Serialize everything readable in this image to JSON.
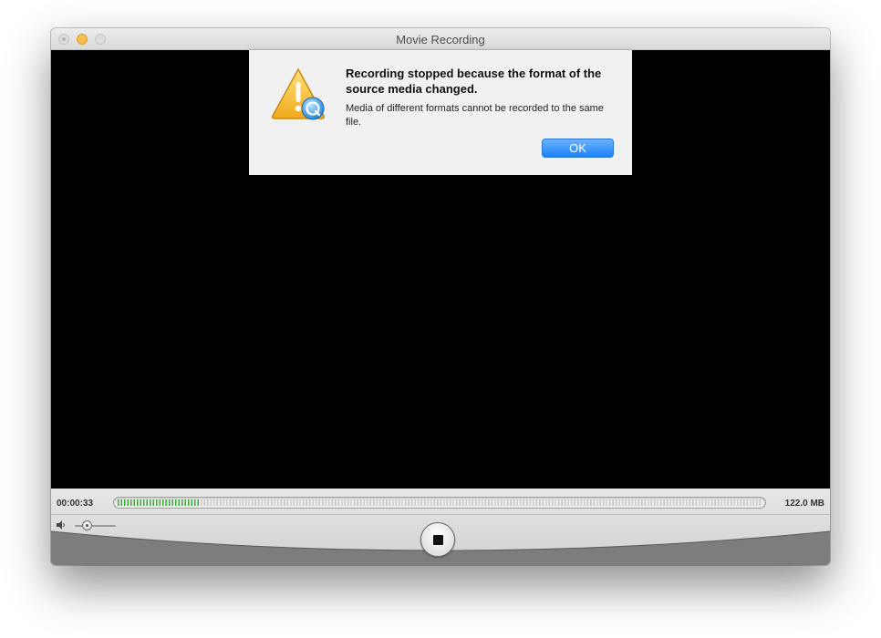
{
  "window": {
    "title": "Movie Recording"
  },
  "alert": {
    "title": "Recording stopped because the format of the source media changed.",
    "message": "Media of different formats cannot be recorded to the same file.",
    "ok_label": "OK",
    "icon": "warning-quicktime-icon"
  },
  "recording": {
    "elapsed": "00:00:33",
    "file_size": "122.0 MB",
    "audio_level_fraction": 0.13,
    "volume_fraction": 0.3
  },
  "colors": {
    "accent": "#1a82fb",
    "level_meter": "#3fa63f",
    "video_background": "#000000"
  },
  "icons": {
    "volume": "speaker-icon",
    "stop": "stop-icon"
  }
}
